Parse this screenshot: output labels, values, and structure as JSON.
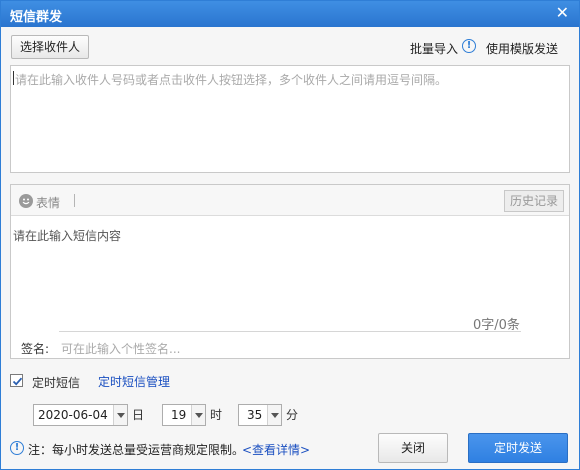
{
  "window": {
    "title": "短信群发",
    "close_glyph": "✕"
  },
  "header": {
    "select_recipients_label": "选择收件人",
    "bulk_import_label": "批量导入",
    "info_glyph": "!",
    "use_template_label": "使用模版发送"
  },
  "recipients": {
    "placeholder": "请在此输入收件人号码或者点击收件人按钮选择，多个收件人之间请用逗号间隔。"
  },
  "composer": {
    "emoji_label": "表情",
    "history_label": "历史记录",
    "message_placeholder": "请在此输入短信内容",
    "counter": "0字/0条",
    "signature_label": "签名:",
    "signature_placeholder": "可在此输入个性签名..."
  },
  "schedule": {
    "checked": true,
    "checkbox_label": "定时短信",
    "manage_link": "定时短信管理",
    "date_value": "2020-06-04",
    "date_unit": "日",
    "hour_value": "19",
    "hour_unit": "时",
    "minute_value": "35",
    "minute_unit": "分"
  },
  "footer": {
    "note": "注：每小时发送总量受运营商规定限制。",
    "details_link": "<查看详情>",
    "close_label": "关闭",
    "send_label": "定时发送"
  },
  "colors": {
    "titlebar": "#2a75cf",
    "accent": "#2f7ed6",
    "primary_button": "#2f80e2",
    "link": "#1a4fc0"
  },
  "icons": [
    "close-icon",
    "info-icon",
    "smiley-icon",
    "check-icon",
    "dropdown-arrow-icon"
  ]
}
